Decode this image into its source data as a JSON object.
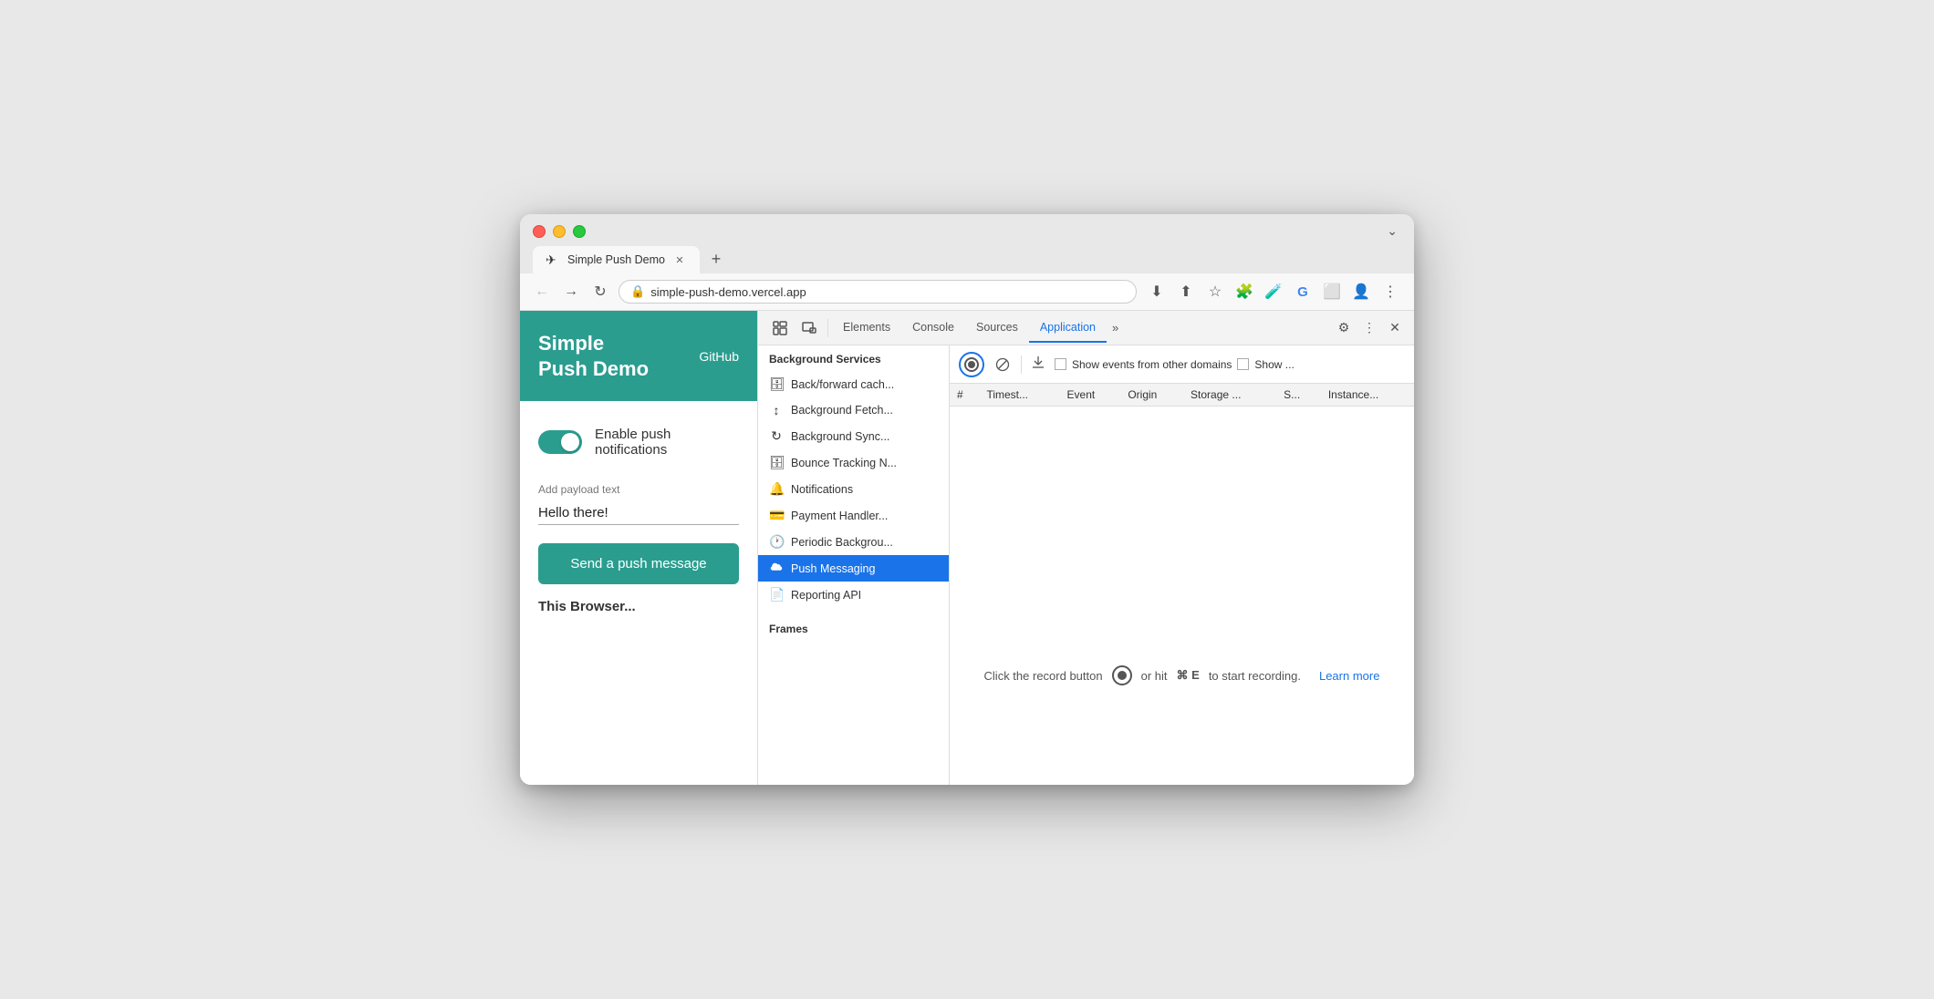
{
  "browser": {
    "tab": {
      "title": "Simple Push Demo",
      "icon": "✈"
    },
    "url": "simple-push-demo.vercel.app",
    "new_tab_label": "+",
    "chevron_label": "⌄"
  },
  "toolbar": {
    "back_label": "←",
    "forward_label": "→",
    "refresh_label": "↻",
    "download_label": "⬇",
    "share_label": "⬆",
    "bookmark_label": "☆",
    "extensions_label": "🧩",
    "lab_label": "🧪",
    "google_label": "G",
    "split_label": "⬜",
    "profile_label": "👤",
    "more_label": "⋮"
  },
  "website": {
    "title_line1": "Simple",
    "title_line2": "Push Demo",
    "github_label": "GitHub",
    "toggle_label": "Enable push notifications",
    "payload_label": "Add payload text",
    "payload_value": "Hello there!",
    "send_button_label": "Send a push message",
    "this_browser_label": "This Browser..."
  },
  "devtools": {
    "tabs": [
      {
        "label": "Elements",
        "active": false
      },
      {
        "label": "Console",
        "active": false
      },
      {
        "label": "Sources",
        "active": false
      },
      {
        "label": "Application",
        "active": true
      }
    ],
    "more_label": "»",
    "settings_label": "⚙",
    "kebab_label": "⋮",
    "close_label": "✕",
    "sidebar": {
      "section_title": "Background Services",
      "items": [
        {
          "icon": "🗄",
          "label": "Back/forward cach..."
        },
        {
          "icon": "↑↓",
          "label": "Background Fetch..."
        },
        {
          "icon": "↻",
          "label": "Background Sync..."
        },
        {
          "icon": "🗄",
          "label": "Bounce Tracking N..."
        },
        {
          "icon": "🔔",
          "label": "Notifications"
        },
        {
          "icon": "💳",
          "label": "Payment Handler..."
        },
        {
          "icon": "🕐",
          "label": "Periodic Backgrou..."
        },
        {
          "icon": "☁",
          "label": "Push Messaging",
          "active": true
        },
        {
          "icon": "📄",
          "label": "Reporting API"
        }
      ],
      "frames_label": "Frames"
    },
    "toolbar": {
      "record_title": "Record",
      "clear_title": "Clear",
      "download_title": "Export",
      "checkbox1_label": "Show events from other domains",
      "checkbox2_label": "Show ..."
    },
    "table": {
      "columns": [
        "#",
        "Timest...",
        "Event",
        "Origin",
        "Storage ...",
        "S...",
        "Instance..."
      ]
    },
    "empty_state": {
      "message": "Click the record button",
      "middle": "or hit",
      "shortcut": "⌘ E",
      "end": "to start recording."
    },
    "learn_more_label": "Learn more"
  }
}
